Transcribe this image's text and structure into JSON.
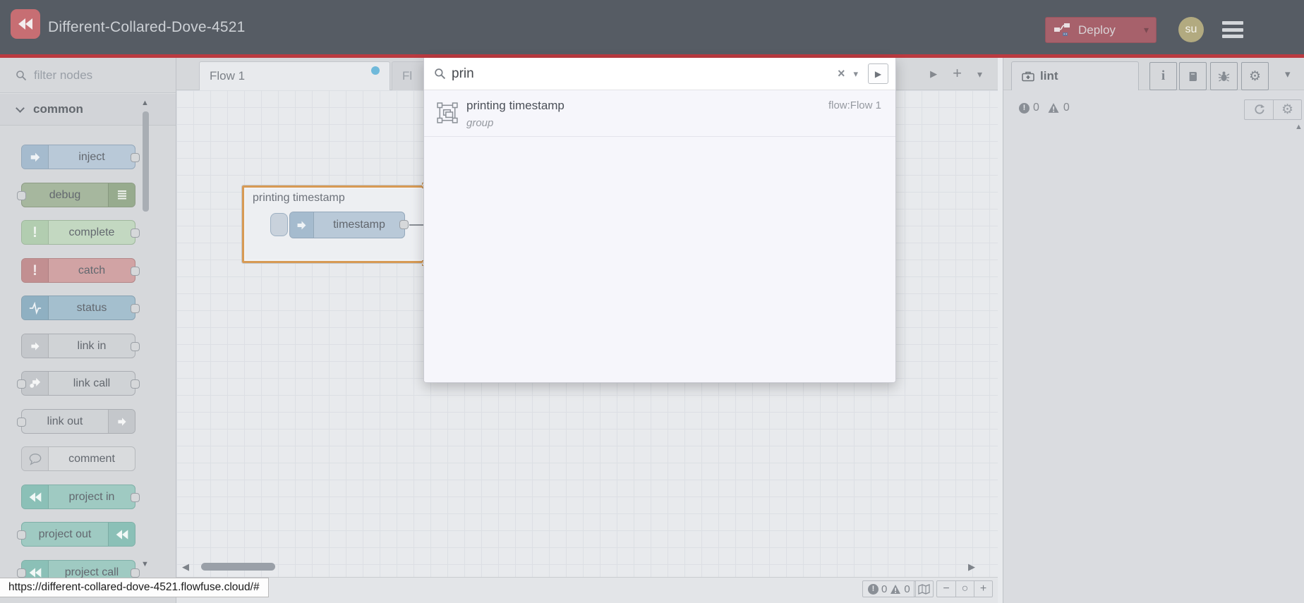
{
  "header": {
    "title": "Different-Collared-Dove-4521",
    "deploy_label": "Deploy",
    "avatar_initials": "su"
  },
  "colors": {
    "header_bg": "#565c64",
    "brand_red_line": "#bb3a40",
    "deploy_red": "#a7616b",
    "logo_red": "#c76e73",
    "unsaved_dot_blue": "#6fb9da",
    "group_highlight_orange": "#d79a54"
  },
  "glyphs": {
    "caret_down": "▾",
    "play": "▶",
    "plus": "+",
    "scroll_left": "◀",
    "scroll_right": "▶",
    "scroll_up": "▲",
    "scroll_down": "▼",
    "close": "×",
    "zoom_out": "−",
    "zoom_reset": "○",
    "zoom_in": "+"
  },
  "palette": {
    "filter_placeholder": "filter nodes",
    "category": "common",
    "nodes": [
      {
        "label": "inject",
        "color": "#b9c9d8",
        "icon": "arrow-in-icon"
      },
      {
        "label": "debug",
        "color": "#a6b79e",
        "icon": "list-icon"
      },
      {
        "label": "complete",
        "color": "#c3d8c1",
        "icon": "exclamation-icon"
      },
      {
        "label": "catch",
        "color": "#d1a3a4",
        "icon": "exclamation-icon"
      },
      {
        "label": "status",
        "color": "#a4bfce",
        "icon": "pulse-icon"
      },
      {
        "label": "link in",
        "color": "#d0d3d6",
        "icon": "link-arrow-icon"
      },
      {
        "label": "link call",
        "color": "#d0d3d6",
        "icon": "link-call-icon"
      },
      {
        "label": "link out",
        "color": "#d0d3d6",
        "icon": "link-arrow-icon"
      },
      {
        "label": "comment",
        "color": "#d9dbdd",
        "icon": "comment-bubble-icon"
      },
      {
        "label": "project in",
        "color": "#9fcac2",
        "icon": "flowfuse-logo-icon"
      },
      {
        "label": "project out",
        "color": "#9fcac2",
        "icon": "flowfuse-logo-icon"
      },
      {
        "label": "project call",
        "color": "#9fcac2",
        "icon": "flowfuse-logo-icon"
      }
    ]
  },
  "workspace": {
    "tabs": [
      {
        "label": "Flow 1",
        "unsaved": true
      },
      {
        "label": "Fl"
      }
    ],
    "group": {
      "label": "printing timestamp",
      "node_label": "timestamp"
    }
  },
  "search": {
    "value": "prin",
    "results": [
      {
        "name": "printing timestamp",
        "type": "group",
        "flow": "flow:Flow 1"
      }
    ]
  },
  "sidebar": {
    "tab_label": "lint",
    "toolbar_icons": [
      "info",
      "book",
      "bug",
      "gear"
    ],
    "error_count": "0",
    "warning_count": "0"
  },
  "canvas_footer": {
    "error_count": "0",
    "warning_count": "0"
  },
  "statusbar": {
    "url": "https://different-collared-dove-4521.flowfuse.cloud/#"
  }
}
